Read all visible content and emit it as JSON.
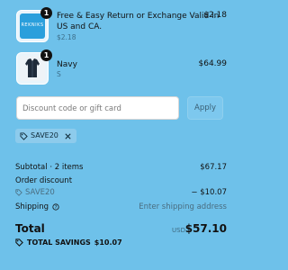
{
  "line_items": [
    {
      "quantity": "1",
      "title_line1": "Free & Easy Return or Exchange Valid in",
      "title_line2": "US and CA.",
      "subtitle": "$2.18",
      "price": "$2.18",
      "thumb_text": "REKNIKS"
    },
    {
      "quantity": "1",
      "title_line1": "Navy",
      "subtitle": "S",
      "price": "$64.99"
    }
  ],
  "discount": {
    "placeholder": "Discount code or gift card",
    "apply_label": "Apply",
    "applied_code": "SAVE20"
  },
  "summary": {
    "subtotal_label": "Subtotal · 2 items",
    "subtotal_value": "$67.17",
    "order_discount_label": "Order discount",
    "order_discount_code": "SAVE20",
    "order_discount_value": "− $10.07",
    "shipping_label": "Shipping",
    "shipping_value": "Enter shipping address",
    "total_label": "Total",
    "total_currency": "USD",
    "total_value": "$57.10",
    "total_savings_label": "TOTAL SAVINGS",
    "total_savings_value": "$10.07"
  },
  "colors": {
    "background": "#6ec1ea",
    "thumb_blue": "#2a9fdc",
    "jacket": "#1f2b3a"
  },
  "icons": [
    "tag-icon",
    "close-icon",
    "info-icon"
  ]
}
